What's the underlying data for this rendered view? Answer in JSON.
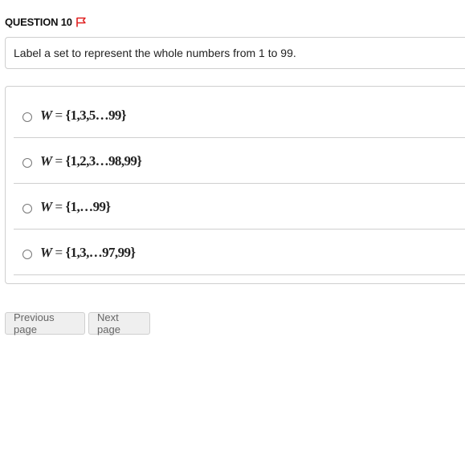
{
  "question": {
    "label": "QUESTION 10",
    "prompt": "Label a set to represent the whole numbers from 1 to 99."
  },
  "options": [
    {
      "var": "W",
      "eq": "=",
      "set": "{1,3,5…99}"
    },
    {
      "var": "W",
      "eq": "=",
      "set": "{1,2,3…98,99}"
    },
    {
      "var": "W",
      "eq": "=",
      "set": "{1,…99}"
    },
    {
      "var": "W",
      "eq": "=",
      "set": "{1,3,…97,99}"
    }
  ],
  "nav": {
    "previous_label": "Previous page",
    "next_label": "Next page"
  },
  "colors": {
    "flag": "#e02020",
    "border": "#cfcfcf",
    "button_bg": "#efefef"
  }
}
